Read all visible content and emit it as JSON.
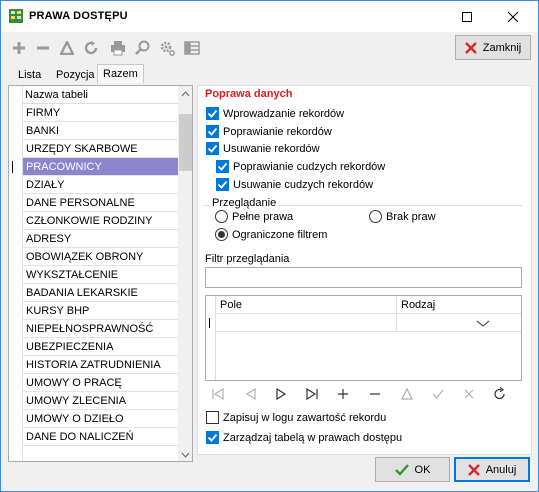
{
  "window": {
    "title": "PRAWA DOSTĘPU",
    "accent": "#0078d7"
  },
  "toolbar": {
    "icons": [
      "add-icon",
      "remove-icon",
      "filter-icon",
      "refresh-icon",
      "print-icon",
      "search-icon",
      "settings-icon",
      "columns-icon"
    ],
    "close_label": "Zamknij"
  },
  "tabs": [
    {
      "label": "Lista"
    },
    {
      "label": "Pozycja"
    },
    {
      "label": "Razem",
      "active": true
    }
  ],
  "table": {
    "header": "Nazwa tabeli",
    "rows": [
      "FIRMY",
      "BANKI",
      "URZĘDY SKARBOWE",
      "PRACOWNICY",
      "DZIAŁY",
      "DANE PERSONALNE",
      "CZŁONKOWIE RODZINY",
      "ADRESY",
      "OBOWIĄZEK OBRONY",
      "WYKSZTAŁCENIE",
      "BADANIA LEKARSKIE",
      "KURSY BHP",
      "NIEPEŁNOSPRAWNOŚĆ",
      "UBEZPIECZENIA",
      "HISTORIA ZATRUDNIENIA",
      "UMOWY O PRACĘ",
      "UMOWY ZLECENIA",
      "UMOWY O DZIEŁO",
      "DANE DO NALICZEŃ"
    ],
    "selected_index": 3,
    "selected_color": "#8c84cc"
  },
  "permissions": {
    "title": "Poprawa danych",
    "title_color": "#e31a1a",
    "items": [
      {
        "label": "Wprowadzanie rekordów",
        "checked": true
      },
      {
        "label": "Poprawianie rekordów",
        "checked": true
      },
      {
        "label": "Usuwanie rekordów",
        "checked": true
      },
      {
        "label": "Poprawianie cudzych rekordów",
        "checked": true
      },
      {
        "label": "Usuwanie cudzych rekordów",
        "checked": true
      }
    ]
  },
  "browse": {
    "label": "Przeglądanie",
    "options": [
      {
        "label": "Pełne prawa",
        "selected": false
      },
      {
        "label": "Brak praw",
        "selected": false
      },
      {
        "label": "Ograniczone filtrem",
        "selected": true
      }
    ]
  },
  "filter": {
    "label": "Filtr przeglądania",
    "value": ""
  },
  "grid": {
    "columns": [
      "Pole",
      "Rodzaj"
    ]
  },
  "nav_icons": [
    "first-icon",
    "prev-icon",
    "next-icon",
    "last-icon",
    "insert-icon",
    "delete-icon",
    "edit-icon",
    "post-icon",
    "cancel-icon",
    "refresh-icon"
  ],
  "options": [
    {
      "label": "Zapisuj w logu zawartość rekordu",
      "checked": false
    },
    {
      "label": "Zarządzaj tabelą w prawach dostępu",
      "checked": true
    }
  ],
  "footer": {
    "ok_label": "OK",
    "cancel_label": "Anuluj"
  }
}
